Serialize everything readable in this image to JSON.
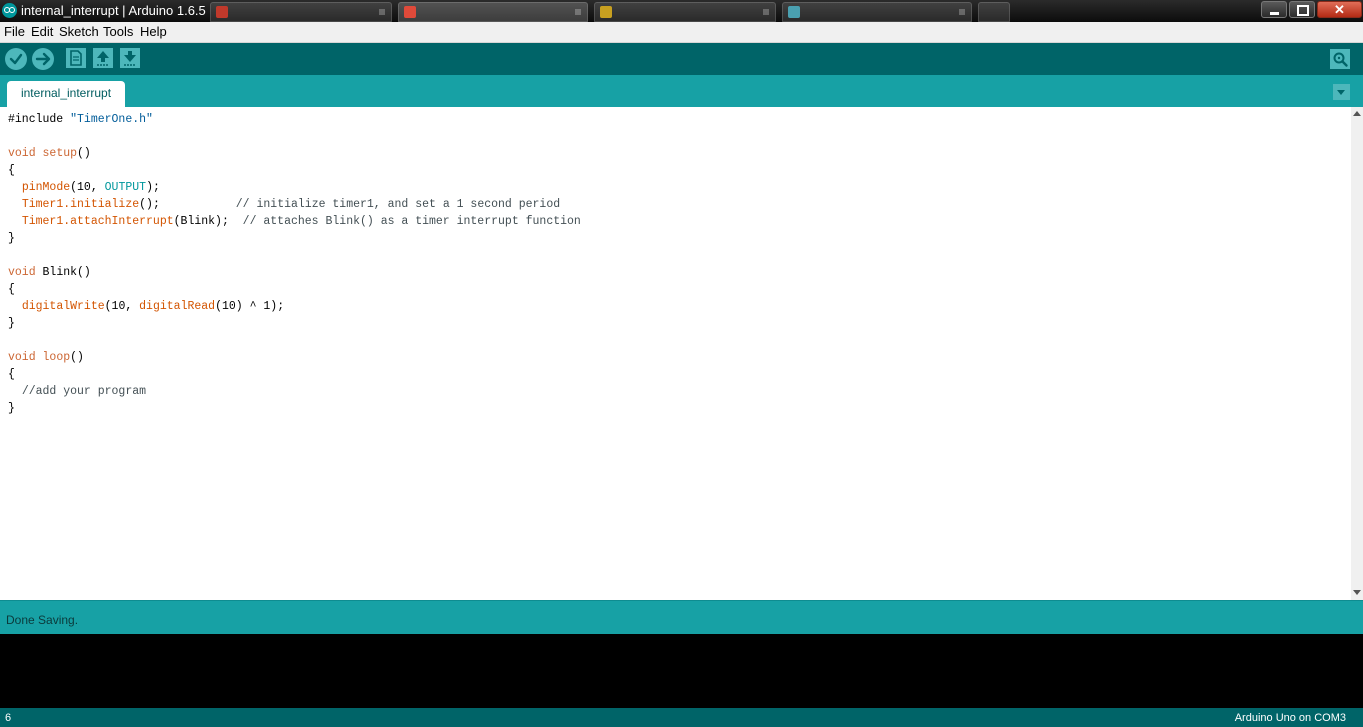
{
  "window": {
    "title": "internal_interrupt | Arduino 1.6.5",
    "close_glyph": "✕"
  },
  "menu": [
    "File",
    "Edit",
    "Sketch",
    "Tools",
    "Help"
  ],
  "tabs": [
    {
      "label": "internal_interrupt"
    }
  ],
  "code": {
    "include_directive": "#include",
    "include_file": "\"TimerOne.h\"",
    "void_kw": "void",
    "setup_fn": "setup",
    "blink_fn": "Blink",
    "loop_fn": "loop",
    "parens": "()",
    "open_brace": "{",
    "close_brace": "}",
    "pinmode_fn": "pinMode",
    "pinmode_args_start": "(10, ",
    "output_const": "OUTPUT",
    "pinmode_args_end": ");",
    "timer_init": "Timer1.initialize",
    "timer_init_args": "();",
    "timer_init_comment": "// initialize timer1, and set a 1 second period",
    "timer_attach": "Timer1.attachInterrupt",
    "timer_attach_args": "(Blink);",
    "timer_attach_comment": "// attaches Blink() as a timer interrupt function",
    "digitalwrite_fn": "digitalWrite",
    "digitalwrite_args_start": "(10, ",
    "digitalread_fn": "digitalRead",
    "digitalread_args": "(10) ^ 1);",
    "loop_comment": "//add your program"
  },
  "status": {
    "message": "Done Saving."
  },
  "footer": {
    "line": "6",
    "board": "Arduino Uno on COM3"
  },
  "colors": {
    "toolbar": "#006468",
    "tab_strip": "#17a1a5",
    "button": "#4db7bb",
    "console": "#000000"
  },
  "icons": {
    "verify": "checkmark-icon",
    "upload": "arrow-right-icon",
    "new": "document-icon",
    "open": "arrow-up-icon",
    "save": "arrow-down-icon",
    "serial_monitor": "magnifier-icon",
    "tab_menu": "triangle-down-icon"
  }
}
